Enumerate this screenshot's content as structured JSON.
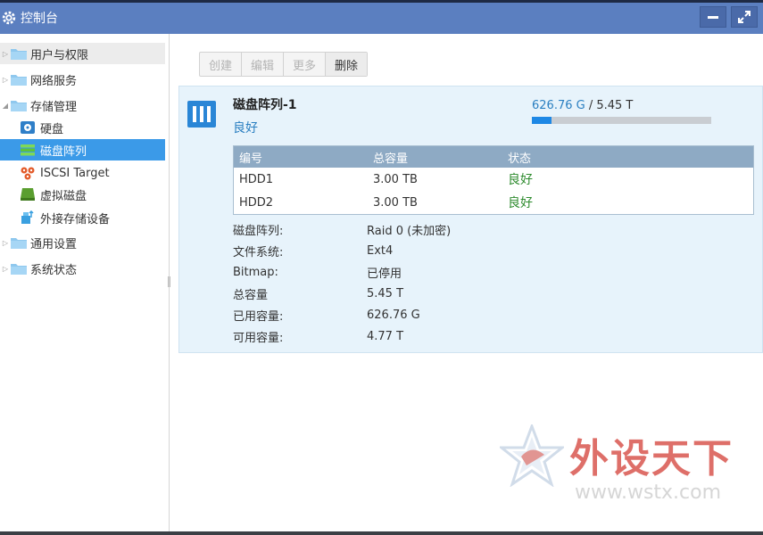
{
  "window": {
    "title": "控制台"
  },
  "sidebar": {
    "items": [
      {
        "label": "用户与权限"
      },
      {
        "label": "网络服务"
      },
      {
        "label": "存储管理"
      },
      {
        "label": "硬盘"
      },
      {
        "label": "磁盘阵列"
      },
      {
        "label": "ISCSI Target"
      },
      {
        "label": "虚拟磁盘"
      },
      {
        "label": "外接存储设备"
      },
      {
        "label": "通用设置"
      },
      {
        "label": "系统状态"
      }
    ]
  },
  "toolbar": {
    "create": "创建",
    "edit": "编辑",
    "more": "更多",
    "delete": "删除"
  },
  "array": {
    "name": "磁盘阵列-1",
    "status": "良好",
    "used": "626.76 G",
    "separator": " / ",
    "total": "5.45 T",
    "usage_fraction": 0.11
  },
  "disk_table": {
    "headers": [
      "编号",
      "总容量",
      "状态"
    ],
    "rows": [
      {
        "id": "HDD1",
        "capacity": "3.00 TB",
        "status": "良好"
      },
      {
        "id": "HDD2",
        "capacity": "3.00 TB",
        "status": "良好"
      }
    ]
  },
  "info": {
    "rows": [
      {
        "key": "磁盘阵列:",
        "value": "Raid 0 (未加密)"
      },
      {
        "key": "文件系统:",
        "value": "Ext4"
      },
      {
        "key": "Bitmap:",
        "value": "已停用"
      },
      {
        "key": "总容量",
        "value": "5.45 T"
      },
      {
        "key": "已用容量:",
        "value": "626.76 G"
      },
      {
        "key": "可用容量:",
        "value": "4.77 T"
      }
    ]
  },
  "watermark": {
    "brand": "外设天下",
    "url": "www.wstx.com"
  },
  "colors": {
    "titlebar": "#5b7fc0",
    "selected": "#3b9ae8",
    "good": "#2e8b2e",
    "link": "#2a7fc1"
  }
}
